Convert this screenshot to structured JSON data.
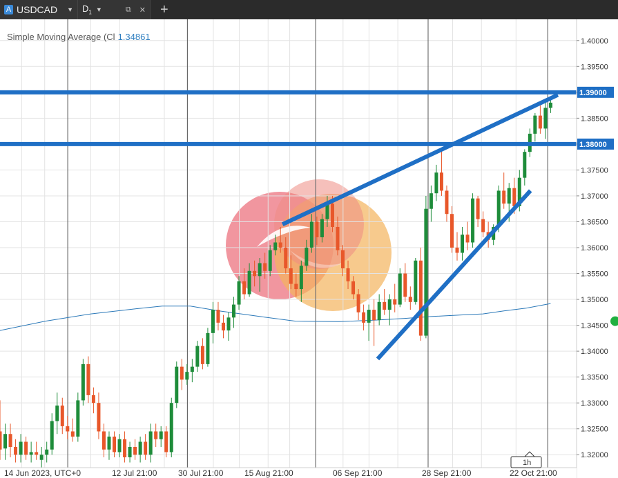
{
  "toolbar": {
    "symbol_badge": "A",
    "symbol": "USDCAD",
    "timeframe_letter": "D",
    "timeframe_sub": "1"
  },
  "indicator": {
    "name": "Simple Moving Average (Cl",
    "value": "1.34861"
  },
  "colors": {
    "bull": "#1e8c3a",
    "bear": "#e8572a",
    "trendline": "#1f6fc5",
    "sma": "#2a78b8",
    "grid": "#e3e3e3",
    "vline": "#555555"
  },
  "chart_data": {
    "type": "candlestick",
    "y_axis": {
      "ticks": [
        "1.40000",
        "1.39500",
        "1.39000",
        "1.38500",
        "1.38000",
        "1.37500",
        "1.37000",
        "1.36500",
        "1.36000",
        "1.35500",
        "1.35000",
        "1.34500",
        "1.34000",
        "1.33500",
        "1.33000",
        "1.32500",
        "1.32000"
      ],
      "range": [
        1.3175,
        1.4041
      ]
    },
    "x_axis": {
      "labels": [
        "14 Jun 2023, UTC+0",
        "12 Jul 21:00",
        "30 Jul 21:00",
        "15 Aug 21:00",
        "06 Sep 21:00",
        "28 Sep 21:00",
        "22 Oct 21:00"
      ]
    },
    "horizontal_lines": [
      {
        "price": 1.39,
        "label": "1.39000"
      },
      {
        "price": 1.38,
        "label": "1.38000"
      }
    ],
    "timeframe_box": "1h",
    "candles": [
      [
        1.3245,
        1.3305,
        1.319,
        1.321
      ],
      [
        1.3212,
        1.326,
        1.319,
        1.324
      ],
      [
        1.324,
        1.326,
        1.3195,
        1.3215
      ],
      [
        1.3215,
        1.323,
        1.3185,
        1.32
      ],
      [
        1.32,
        1.324,
        1.3185,
        1.3225
      ],
      [
        1.3225,
        1.3235,
        1.319,
        1.32
      ],
      [
        1.32,
        1.3225,
        1.3185,
        1.3205
      ],
      [
        1.3205,
        1.3225,
        1.319,
        1.32
      ],
      [
        1.319,
        1.3215,
        1.3175,
        1.32
      ],
      [
        1.32,
        1.3225,
        1.3185,
        1.321
      ],
      [
        1.321,
        1.328,
        1.32,
        1.3265
      ],
      [
        1.3265,
        1.332,
        1.324,
        1.3295
      ],
      [
        1.3295,
        1.331,
        1.324,
        1.3255
      ],
      [
        1.3255,
        1.3275,
        1.323,
        1.3245
      ],
      [
        1.3245,
        1.327,
        1.3225,
        1.3235
      ],
      [
        1.3235,
        1.332,
        1.3225,
        1.3305
      ],
      [
        1.3305,
        1.3385,
        1.3295,
        1.3375
      ],
      [
        1.3375,
        1.339,
        1.33,
        1.3315
      ],
      [
        1.3315,
        1.333,
        1.328,
        1.33
      ],
      [
        1.33,
        1.332,
        1.323,
        1.3245
      ],
      [
        1.3245,
        1.326,
        1.3195,
        1.321
      ],
      [
        1.321,
        1.3245,
        1.319,
        1.3235
      ],
      [
        1.3235,
        1.3245,
        1.3195,
        1.3205
      ],
      [
        1.3205,
        1.324,
        1.3195,
        1.323
      ],
      [
        1.323,
        1.3245,
        1.3185,
        1.3195
      ],
      [
        1.3195,
        1.3225,
        1.3185,
        1.3215
      ],
      [
        1.3215,
        1.323,
        1.319,
        1.32
      ],
      [
        1.32,
        1.3235,
        1.3185,
        1.3225
      ],
      [
        1.3225,
        1.324,
        1.319,
        1.32
      ],
      [
        1.32,
        1.326,
        1.3185,
        1.3245
      ],
      [
        1.3245,
        1.326,
        1.3215,
        1.323
      ],
      [
        1.323,
        1.3255,
        1.3215,
        1.3245
      ],
      [
        1.3245,
        1.3255,
        1.3195,
        1.3205
      ],
      [
        1.3205,
        1.331,
        1.3195,
        1.33
      ],
      [
        1.33,
        1.338,
        1.329,
        1.337
      ],
      [
        1.337,
        1.3385,
        1.3325,
        1.3345
      ],
      [
        1.3345,
        1.3375,
        1.3335,
        1.336
      ],
      [
        1.336,
        1.3385,
        1.334,
        1.337
      ],
      [
        1.337,
        1.342,
        1.336,
        1.341
      ],
      [
        1.341,
        1.3425,
        1.3365,
        1.3375
      ],
      [
        1.3375,
        1.3445,
        1.337,
        1.3435
      ],
      [
        1.3435,
        1.3495,
        1.3415,
        1.348
      ],
      [
        1.348,
        1.3495,
        1.344,
        1.3455
      ],
      [
        1.3455,
        1.347,
        1.3425,
        1.344
      ],
      [
        1.344,
        1.3475,
        1.342,
        1.3465
      ],
      [
        1.3465,
        1.3505,
        1.3445,
        1.349
      ],
      [
        1.349,
        1.3545,
        1.348,
        1.3535
      ],
      [
        1.3535,
        1.356,
        1.35,
        1.351
      ],
      [
        1.351,
        1.357,
        1.3505,
        1.3555
      ],
      [
        1.3555,
        1.3575,
        1.3525,
        1.3545
      ],
      [
        1.3545,
        1.358,
        1.3515,
        1.357
      ],
      [
        1.357,
        1.359,
        1.354,
        1.3555
      ],
      [
        1.3555,
        1.3605,
        1.3545,
        1.3595
      ],
      [
        1.3595,
        1.3625,
        1.3585,
        1.361
      ],
      [
        1.361,
        1.364,
        1.359,
        1.36
      ],
      [
        1.36,
        1.362,
        1.355,
        1.356
      ],
      [
        1.356,
        1.3585,
        1.352,
        1.353
      ],
      [
        1.353,
        1.355,
        1.3505,
        1.352
      ],
      [
        1.352,
        1.3575,
        1.3495,
        1.3565
      ],
      [
        1.3565,
        1.3615,
        1.3555,
        1.36
      ],
      [
        1.36,
        1.3665,
        1.359,
        1.365
      ],
      [
        1.365,
        1.366,
        1.3605,
        1.362
      ],
      [
        1.362,
        1.3665,
        1.361,
        1.3655
      ],
      [
        1.3655,
        1.37,
        1.364,
        1.3685
      ],
      [
        1.3685,
        1.37,
        1.363,
        1.364
      ],
      [
        1.364,
        1.366,
        1.3585,
        1.3595
      ],
      [
        1.3595,
        1.3605,
        1.3545,
        1.356
      ],
      [
        1.356,
        1.3575,
        1.352,
        1.3535
      ],
      [
        1.3535,
        1.3545,
        1.35,
        1.351
      ],
      [
        1.351,
        1.352,
        1.346,
        1.3475
      ],
      [
        1.3475,
        1.349,
        1.344,
        1.3455
      ],
      [
        1.3455,
        1.349,
        1.342,
        1.348
      ],
      [
        1.348,
        1.35,
        1.341,
        1.346
      ],
      [
        1.346,
        1.351,
        1.345,
        1.3495
      ],
      [
        1.3495,
        1.352,
        1.347,
        1.348
      ],
      [
        1.348,
        1.351,
        1.345,
        1.35
      ],
      [
        1.35,
        1.353,
        1.3475,
        1.349
      ],
      [
        1.349,
        1.356,
        1.3485,
        1.355
      ],
      [
        1.355,
        1.357,
        1.3495,
        1.3505
      ],
      [
        1.3505,
        1.3525,
        1.348,
        1.3495
      ],
      [
        1.3495,
        1.358,
        1.349,
        1.3575
      ],
      [
        1.3575,
        1.36,
        1.342,
        1.343
      ],
      [
        1.343,
        1.37,
        1.3425,
        1.3675
      ],
      [
        1.3675,
        1.372,
        1.365,
        1.3705
      ],
      [
        1.3705,
        1.376,
        1.369,
        1.3745
      ],
      [
        1.3745,
        1.379,
        1.37,
        1.371
      ],
      [
        1.371,
        1.372,
        1.365,
        1.3665
      ],
      [
        1.3665,
        1.368,
        1.359,
        1.36
      ],
      [
        1.36,
        1.363,
        1.3575,
        1.359
      ],
      [
        1.359,
        1.364,
        1.3575,
        1.3625
      ],
      [
        1.3625,
        1.365,
        1.3595,
        1.361
      ],
      [
        1.361,
        1.3705,
        1.36,
        1.3695
      ],
      [
        1.3695,
        1.37,
        1.364,
        1.3655
      ],
      [
        1.3655,
        1.367,
        1.362,
        1.363
      ],
      [
        1.363,
        1.365,
        1.36,
        1.3615
      ],
      [
        1.3615,
        1.3645,
        1.3605,
        1.364
      ],
      [
        1.364,
        1.372,
        1.363,
        1.371
      ],
      [
        1.371,
        1.3745,
        1.3675,
        1.3685
      ],
      [
        1.3685,
        1.3725,
        1.365,
        1.3715
      ],
      [
        1.3715,
        1.3735,
        1.3665,
        1.368
      ],
      [
        1.368,
        1.375,
        1.367,
        1.3735
      ],
      [
        1.3735,
        1.379,
        1.372,
        1.3785
      ],
      [
        1.3785,
        1.383,
        1.3775,
        1.382
      ],
      [
        1.382,
        1.386,
        1.3805,
        1.3855
      ],
      [
        1.3855,
        1.3875,
        1.382,
        1.383
      ],
      [
        1.383,
        1.388,
        1.381,
        1.387
      ],
      [
        1.387,
        1.389,
        1.386,
        1.388
      ]
    ],
    "sma": [
      [
        0,
        1.344
      ],
      [
        0.0787,
        1.3458
      ],
      [
        0.1576,
        1.3472
      ],
      [
        0.2362,
        1.3482
      ],
      [
        0.2813,
        1.3487
      ],
      [
        0.33,
        1.3487
      ],
      [
        0.379,
        1.3478
      ],
      [
        0.45,
        1.3467
      ],
      [
        0.5125,
        1.3458
      ],
      [
        0.5875,
        1.3457
      ],
      [
        0.65,
        1.346
      ],
      [
        0.7,
        1.3463
      ],
      [
        0.75,
        1.3467
      ],
      [
        0.8,
        1.347
      ],
      [
        0.8375,
        1.3472
      ],
      [
        0.875,
        1.3478
      ],
      [
        0.9125,
        1.3483
      ],
      [
        0.955,
        1.3492
      ]
    ],
    "trendlines": [
      [
        [
          0.49,
          1.3645
        ],
        [
          0.9675,
          1.3895
        ]
      ],
      [
        [
          0.655,
          1.3385
        ],
        [
          0.92,
          1.371
        ]
      ]
    ],
    "separators": [
      0.1175,
      0.325,
      0.5475,
      0.7425,
      0.95
    ]
  }
}
